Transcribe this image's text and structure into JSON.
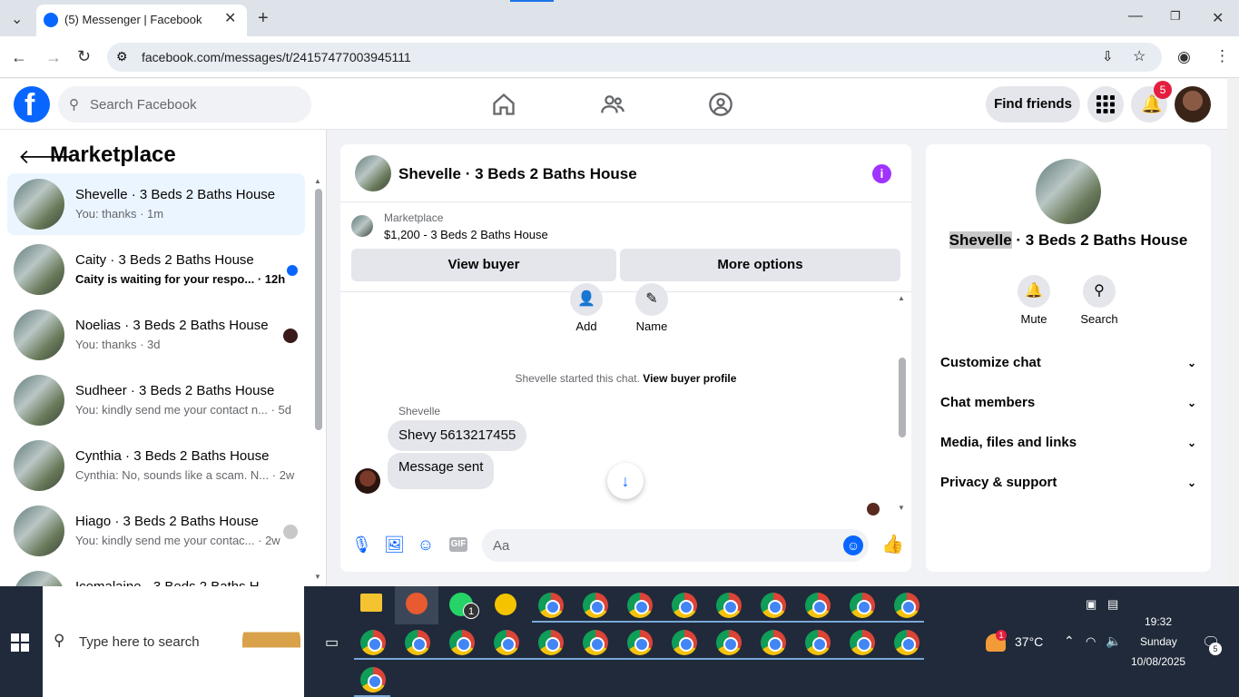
{
  "browser": {
    "tab_title": "(5) Messenger | Facebook",
    "new_tab": "+",
    "url": "facebook.com/messages/t/24157477003945111"
  },
  "fb": {
    "search_placeholder": "Search Facebook",
    "find_friends": "Find friends",
    "notif_count": "5"
  },
  "left": {
    "title": "Marketplace",
    "chats": [
      {
        "name": "Shevelle · 3 Beds 2 Baths House",
        "snippet": "You: thanks · 1m",
        "selected": true
      },
      {
        "name": "Caity · 3 Beds 2 Baths House",
        "snippet": "Caity is waiting for your respo... · 12h",
        "unread": true
      },
      {
        "name": "Noelias · 3 Beds 2 Baths House",
        "snippet": "You: thanks · 3d"
      },
      {
        "name": "Sudheer · 3 Beds 2 Baths House",
        "snippet": "You: kindly send me your contact n... · 5d"
      },
      {
        "name": "Cynthia · 3 Beds 2 Baths House",
        "snippet": "Cynthia: No, sounds like a scam. N... · 2w"
      },
      {
        "name": "Hiago · 3 Beds 2 Baths House",
        "snippet": "You: kindly send me your contac... · 2w"
      },
      {
        "name": "Icemalaine · 3 Beds 2 Baths H",
        "snippet": ""
      }
    ]
  },
  "mid": {
    "title": "Shevelle · 3 Beds 2 Baths House",
    "info": "i",
    "mp_label": "Marketplace",
    "mp_price": "$1,200 - 3 Beds 2 Baths House",
    "view_buyer": "View buyer",
    "more_options": "More options",
    "add_label": "Add",
    "name_label": "Name",
    "started_text": "Shevelle started this chat.",
    "view_buyer_profile": "View buyer profile",
    "sender": "Shevelle",
    "msg1": "Shevy 5613217455",
    "msg2": "Message sent",
    "composer_placeholder": "Aa"
  },
  "right": {
    "title_name": "Shevelle",
    "title_rest": " · 3 Beds 2 Baths House",
    "mute": "Mute",
    "search": "Search",
    "sections": [
      "Customize chat",
      "Chat members",
      "Media, files and links",
      "Privacy & support"
    ]
  },
  "taskbar": {
    "search_placeholder": "Type here to search",
    "whatsapp_badge": "1",
    "weather_badge": "1",
    "temp": "37°C",
    "time": "19:32",
    "day": "Sunday",
    "date": "10/08/2025",
    "notif": "5"
  },
  "colors": {
    "accent": "#0866ff",
    "purple": "#a033ff",
    "selected_row": "#ebf5ff"
  }
}
